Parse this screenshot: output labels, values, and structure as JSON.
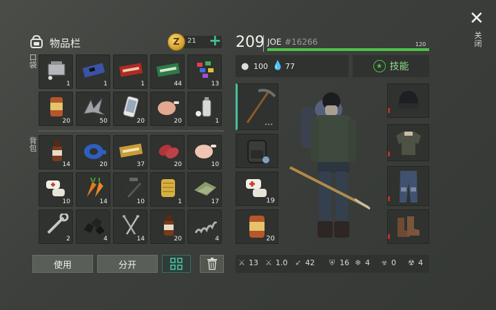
{
  "inventory": {
    "title": "物品栏",
    "coins": "21",
    "add": "+",
    "pocket_label": "口袋",
    "backpack_label": "背包",
    "pocket_slots": [
      {
        "icon": "engine-part-icon",
        "count": "1"
      },
      {
        "icon": "circuit-board-icon",
        "count": "1"
      },
      {
        "icon": "red-coupon-icon",
        "count": "1"
      },
      {
        "icon": "green-coupon-icon",
        "count": "44"
      },
      {
        "icon": "candy-icon",
        "count": "13"
      },
      {
        "icon": "canned-food-icon",
        "count": "20"
      },
      {
        "icon": "metal-scrap-icon",
        "count": "50"
      },
      {
        "icon": "smartphone-icon",
        "count": "20"
      },
      {
        "icon": "roast-chicken-icon",
        "count": "20"
      },
      {
        "icon": "spray-can-icon",
        "count": "1"
      }
    ],
    "backpack_slots": [
      {
        "icon": "bottle-icon",
        "count": "14"
      },
      {
        "icon": "duct-tape-icon",
        "count": "20"
      },
      {
        "icon": "gold-coupon-icon",
        "count": "37"
      },
      {
        "icon": "raw-meat-icon",
        "count": "20"
      },
      {
        "icon": "raw-chicken-icon",
        "count": "10"
      },
      {
        "icon": "first-aid-icon",
        "count": "10"
      },
      {
        "icon": "carrot-icon",
        "count": "14"
      },
      {
        "icon": "tools-icon",
        "count": "10"
      },
      {
        "icon": "filter-icon",
        "count": "1"
      },
      {
        "icon": "cloth-icon",
        "count": "17"
      },
      {
        "icon": "wrench-icon",
        "count": "2"
      },
      {
        "icon": "coal-icon",
        "count": "4"
      },
      {
        "icon": "nails-icon",
        "count": "14"
      },
      {
        "icon": "bottle-icon",
        "count": "20"
      },
      {
        "icon": "spring-icon",
        "count": "4"
      }
    ],
    "use_label": "使用",
    "split_label": "分开"
  },
  "character": {
    "level": "209",
    "name": "JOE",
    "id": "#16266",
    "xp": "120",
    "food": "100",
    "water": "77",
    "skills_label": "技能",
    "hand_slots": [
      {
        "icon": "pickaxe-icon",
        "count": ""
      },
      {
        "icon": "backpack-icon",
        "count": ""
      },
      {
        "icon": "first-aid-icon",
        "count": "19"
      },
      {
        "icon": "canned-food-icon",
        "count": "20"
      }
    ],
    "gear_slots": [
      {
        "icon": "beanie-icon"
      },
      {
        "icon": "jacket-icon"
      },
      {
        "icon": "pants-icon"
      },
      {
        "icon": "boots-icon"
      }
    ]
  },
  "stats": [
    {
      "icon": "sword-icon",
      "value": "13"
    },
    {
      "icon": "speed-attack-icon",
      "value": "1.0"
    },
    {
      "icon": "run-icon",
      "value": "42"
    },
    {
      "icon": "armor-icon",
      "value": "16"
    },
    {
      "icon": "cold-resist-icon",
      "value": "4"
    },
    {
      "icon": "poison-resist-icon",
      "value": "0"
    },
    {
      "icon": "radiation-resist-icon",
      "value": "4"
    }
  ],
  "close_label": "关闭",
  "colors": {
    "accent": "#4fc34a",
    "panel": "#2f322e",
    "teal": "#45c3a0"
  }
}
